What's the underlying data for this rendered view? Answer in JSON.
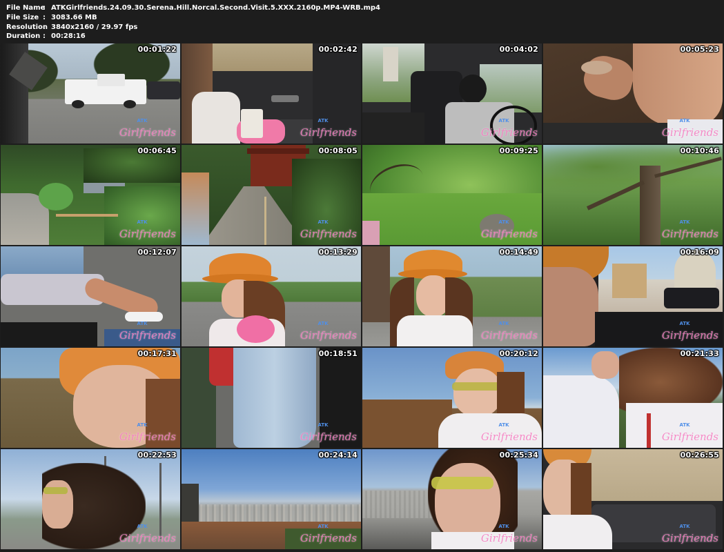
{
  "file_info": [
    {
      "key": "File Name",
      "value": "ATKGirlfriends.24.09.30.Serena.Hill.Norcal.Second.Visit.5.XXX.2160p.MP4-WRB.mp4"
    },
    {
      "key": "File Size",
      "value": "3083.66 MB"
    },
    {
      "key": "Resolution",
      "value": "3840x2160 / 29.97 fps"
    },
    {
      "key": "Duration",
      "value": "00:28:16"
    }
  ],
  "watermark": {
    "brand_top": "ATK",
    "brand_main": "Girlfriends"
  },
  "thumbnails": [
    {
      "time": "00:01:22",
      "scene": "street-truck"
    },
    {
      "time": "00:02:42",
      "scene": "car-cup"
    },
    {
      "time": "00:04:02",
      "scene": "car-driver"
    },
    {
      "time": "00:05:23",
      "scene": "legs-pov"
    },
    {
      "time": "00:06:45",
      "scene": "garden-path"
    },
    {
      "time": "00:08:05",
      "scene": "tea-garden"
    },
    {
      "time": "00:09:25",
      "scene": "green-blur"
    },
    {
      "time": "00:10:46",
      "scene": "tree-canopy"
    },
    {
      "time": "00:12:07",
      "scene": "feet-pov"
    },
    {
      "time": "00:13:29",
      "scene": "hat-road"
    },
    {
      "time": "00:14:49",
      "scene": "hat-smile"
    },
    {
      "time": "00:16:09",
      "scene": "car-window"
    },
    {
      "time": "00:17:31",
      "scene": "hat-closeup"
    },
    {
      "time": "00:18:51",
      "scene": "jeans-walk"
    },
    {
      "time": "00:20:12",
      "scene": "sunglasses-hill"
    },
    {
      "time": "00:21:33",
      "scene": "wind-hair"
    },
    {
      "time": "00:22:53",
      "scene": "hair-sky"
    },
    {
      "time": "00:24:14",
      "scene": "city-view"
    },
    {
      "time": "00:25:34",
      "scene": "sunglasses-view"
    },
    {
      "time": "00:26:55",
      "scene": "car-selfie"
    }
  ],
  "colors": {
    "header_bg": "#1d1d1d",
    "text": "#ffffff",
    "watermark_pink": "#f478be",
    "watermark_blue": "#4f8fe8"
  }
}
